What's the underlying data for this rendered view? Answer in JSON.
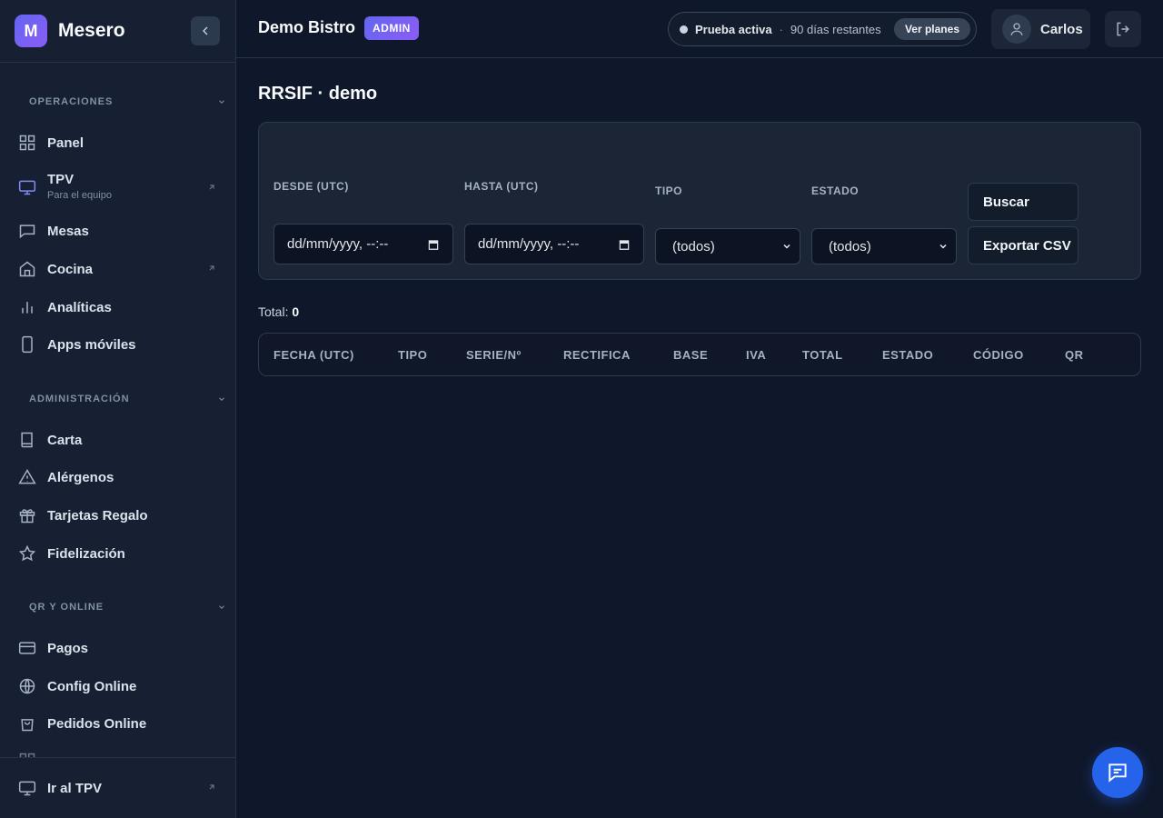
{
  "brand": {
    "logo_letter": "M",
    "name": "Mesero"
  },
  "sidebar": {
    "sections": [
      {
        "title": "OPERACIONES",
        "items": [
          {
            "label": "Panel",
            "icon": "grid-icon"
          },
          {
            "label": "TPV",
            "sub": "Para el equipo",
            "icon": "monitor-icon",
            "external": true
          },
          {
            "label": "Mesas",
            "icon": "chat-icon"
          },
          {
            "label": "Cocina",
            "icon": "home-icon",
            "external": true
          },
          {
            "label": "Analíticas",
            "icon": "bar-chart-icon"
          },
          {
            "label": "Apps móviles",
            "icon": "phone-icon"
          }
        ]
      },
      {
        "title": "ADMINISTRACIÓN",
        "items": [
          {
            "label": "Carta",
            "icon": "book-icon"
          },
          {
            "label": "Alérgenos",
            "icon": "warning-icon"
          },
          {
            "label": "Tarjetas Regalo",
            "icon": "gift-icon"
          },
          {
            "label": "Fidelización",
            "icon": "star-icon"
          }
        ]
      },
      {
        "title": "QR Y ONLINE",
        "items": [
          {
            "label": "Pagos",
            "icon": "card-icon"
          },
          {
            "label": "Config Online",
            "icon": "globe-icon"
          },
          {
            "label": "Pedidos Online",
            "icon": "bag-icon"
          }
        ]
      }
    ],
    "footer": {
      "label": "Ir al TPV",
      "icon": "monitor-icon"
    }
  },
  "header": {
    "org_name": "Demo Bistro",
    "role_badge": "ADMIN",
    "trial": {
      "status": "Prueba activa",
      "separator": "·",
      "days": "90 días restantes",
      "button": "Ver planes"
    },
    "user": {
      "name": "Carlos"
    }
  },
  "main": {
    "title": "RRSIF · demo",
    "filters": {
      "from_label": "DESDE (UTC)",
      "from_value": "dd/mm/yyyy, --:--",
      "to_label": "HASTA (UTC)",
      "to_value": "dd/mm/yyyy, --:--",
      "type_label": "TIPO",
      "type_value": "(todos)",
      "status_label": "ESTADO",
      "status_value": "(todos)",
      "search_button": "Buscar",
      "export_button": "Exportar CSV"
    },
    "total_label": "Total:",
    "total_value": "0",
    "table": {
      "columns": [
        "FECHA (UTC)",
        "TIPO",
        "SERIE/Nº",
        "RECTIFICA",
        "BASE",
        "IVA",
        "TOTAL",
        "ESTADO",
        "CÓDIGO",
        "QR"
      ]
    }
  },
  "colors": {
    "accent": "#6366f1",
    "accent2": "#8b5cf6",
    "fab": "#2563eb",
    "background": "#0f172a"
  }
}
